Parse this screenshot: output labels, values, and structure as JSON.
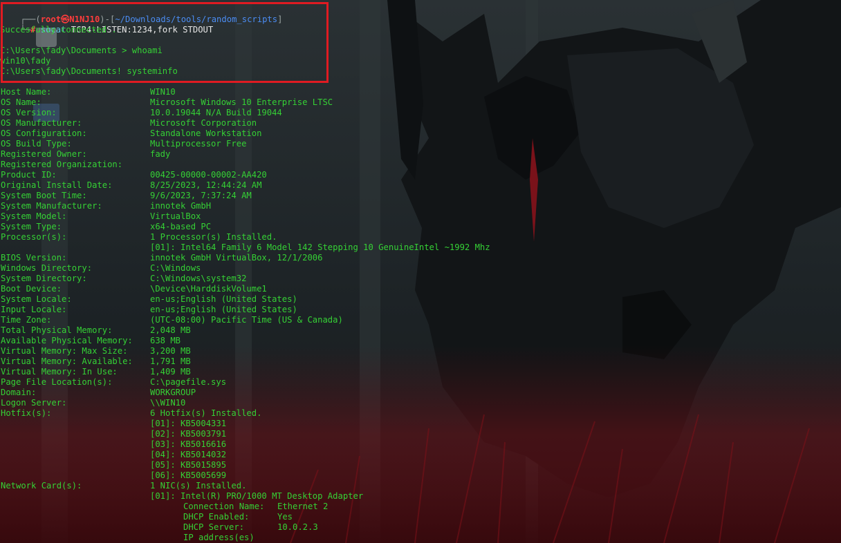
{
  "prompt": {
    "frame_open": "┌──(",
    "user": "root",
    "at": "㉿",
    "host": "N1NJ10",
    "mid": ")-[",
    "path": "~/Downloads/tools/random_scripts",
    "close": "]",
    "frame_bottom": "└─",
    "hash": "#",
    "cmd_name": "socat",
    "cmd_args": " TCP4-LISTEN:1234,fork STDOUT"
  },
  "session": {
    "connected": "Succesfully connected .",
    "blank": "",
    "prompt1": "C:\\Users\\fady\\Documents > whoami",
    "whoami_out": "win10\\fady",
    "prompt2": "C:\\Users\\fady\\Documents! systeminfo"
  },
  "systeminfo": [
    {
      "label": "Host Name:",
      "value": "WIN10"
    },
    {
      "label": "OS Name:",
      "value": "Microsoft Windows 10 Enterprise LTSC"
    },
    {
      "label": "OS Version:",
      "value": "10.0.19044 N/A Build 19044"
    },
    {
      "label": "OS Manufacturer:",
      "value": "Microsoft Corporation"
    },
    {
      "label": "OS Configuration:",
      "value": "Standalone Workstation"
    },
    {
      "label": "OS Build Type:",
      "value": "Multiprocessor Free"
    },
    {
      "label": "Registered Owner:",
      "value": "fady"
    },
    {
      "label": "Registered Organization:",
      "value": ""
    },
    {
      "label": "Product ID:",
      "value": "00425-00000-00002-AA420"
    },
    {
      "label": "Original Install Date:",
      "value": "8/25/2023, 12:44:24 AM"
    },
    {
      "label": "System Boot Time:",
      "value": "9/6/2023, 7:37:24 AM"
    },
    {
      "label": "System Manufacturer:",
      "value": "innotek GmbH"
    },
    {
      "label": "System Model:",
      "value": "VirtualBox"
    },
    {
      "label": "System Type:",
      "value": "x64-based PC"
    },
    {
      "label": "Processor(s):",
      "value": "1 Processor(s) Installed."
    },
    {
      "label": "",
      "value": "[01]: Intel64 Family 6 Model 142 Stepping 10 GenuineIntel ~1992 Mhz"
    },
    {
      "label": "BIOS Version:",
      "value": "innotek GmbH VirtualBox, 12/1/2006"
    },
    {
      "label": "Windows Directory:",
      "value": "C:\\Windows"
    },
    {
      "label": "System Directory:",
      "value": "C:\\Windows\\system32"
    },
    {
      "label": "Boot Device:",
      "value": "\\Device\\HarddiskVolume1"
    },
    {
      "label": "System Locale:",
      "value": "en-us;English (United States)"
    },
    {
      "label": "Input Locale:",
      "value": "en-us;English (United States)"
    },
    {
      "label": "Time Zone:",
      "value": "(UTC-08:00) Pacific Time (US & Canada)"
    },
    {
      "label": "Total Physical Memory:",
      "value": "2,048 MB"
    },
    {
      "label": "Available Physical Memory:",
      "value": "638 MB"
    },
    {
      "label": "Virtual Memory: Max Size:",
      "value": "3,200 MB"
    },
    {
      "label": "Virtual Memory: Available:",
      "value": "1,791 MB"
    },
    {
      "label": "Virtual Memory: In Use:",
      "value": "1,409 MB"
    },
    {
      "label": "Page File Location(s):",
      "value": "C:\\pagefile.sys"
    },
    {
      "label": "Domain:",
      "value": "WORKGROUP"
    },
    {
      "label": "Logon Server:",
      "value": "\\\\WIN10"
    },
    {
      "label": "Hotfix(s):",
      "value": "6 Hotfix(s) Installed."
    },
    {
      "label": "",
      "value": "[01]: KB5004331"
    },
    {
      "label": "",
      "value": "[02]: KB5003791"
    },
    {
      "label": "",
      "value": "[03]: KB5016616"
    },
    {
      "label": "",
      "value": "[04]: KB5014032"
    },
    {
      "label": "",
      "value": "[05]: KB5015895"
    },
    {
      "label": "",
      "value": "[06]: KB5005699"
    },
    {
      "label": "Network Card(s):",
      "value": "1 NIC(s) Installed."
    },
    {
      "label": "",
      "value": "[01]: Intel(R) PRO/1000 MT Desktop Adapter"
    }
  ],
  "nic_details": [
    {
      "key": "Connection Name:",
      "value": "Ethernet 2"
    },
    {
      "key": "DHCP Enabled:",
      "value": "Yes"
    },
    {
      "key": "DHCP Server:",
      "value": "10.0.2.3"
    },
    {
      "key": "IP address(es)",
      "value": ""
    }
  ],
  "colors": {
    "output_green": "#35d135",
    "path_blue": "#4b8cf3",
    "host_red": "#ff3c3c",
    "highlight_border": "#e01b22",
    "background": "#1b1f22"
  }
}
